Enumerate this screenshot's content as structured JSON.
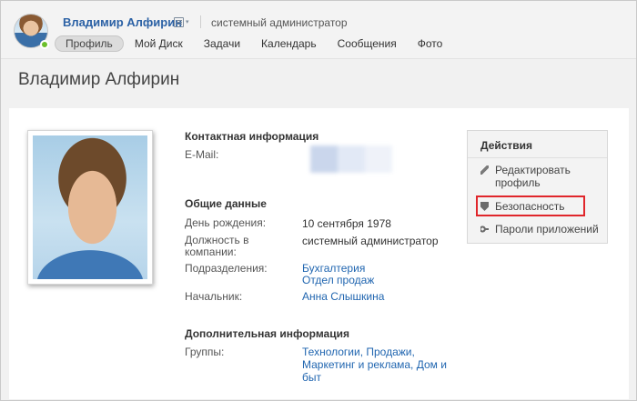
{
  "header": {
    "user_name": "Владимир Алфирин",
    "position": "системный администратор",
    "nav": [
      {
        "label": "Профиль",
        "active": true
      },
      {
        "label": "Мой Диск",
        "active": false
      },
      {
        "label": "Задачи",
        "active": false
      },
      {
        "label": "Календарь",
        "active": false
      },
      {
        "label": "Сообщения",
        "active": false
      },
      {
        "label": "Фото",
        "active": false
      }
    ]
  },
  "page_title": "Владимир Алфирин",
  "profile": {
    "contact_title": "Контактная информация",
    "email_label": "E-Mail:",
    "general_title": "Общие данные",
    "birthday_label": "День рождения:",
    "birthday_value": "10 сентября 1978",
    "position_label_1": "Должность в",
    "position_label_2": "компании:",
    "position_value": "системный администратор",
    "departments_label": "Подразделения:",
    "departments": [
      "Бухгалтерия",
      "Отдел продаж"
    ],
    "manager_label": "Начальник:",
    "manager_value": "Анна Слышкина",
    "extra_title": "Дополнительная информация",
    "groups_label": "Группы:",
    "groups_lines": [
      "Технологии, Продажи,",
      "Маркетинг и реклама, Дом и",
      "быт"
    ]
  },
  "actions": {
    "title": "Действия",
    "items": [
      {
        "label_1": "Редактировать",
        "label_2": "профиль",
        "icon": "pencil-icon"
      },
      {
        "label": "Безопасность",
        "icon": "shield-icon",
        "highlighted": true
      },
      {
        "label": "Пароли приложений",
        "icon": "key-icon"
      }
    ]
  },
  "colors": {
    "link": "#2166b0",
    "user_name": "#2b61a5",
    "online": "#6bbf2a",
    "highlight": "#e0262b"
  }
}
